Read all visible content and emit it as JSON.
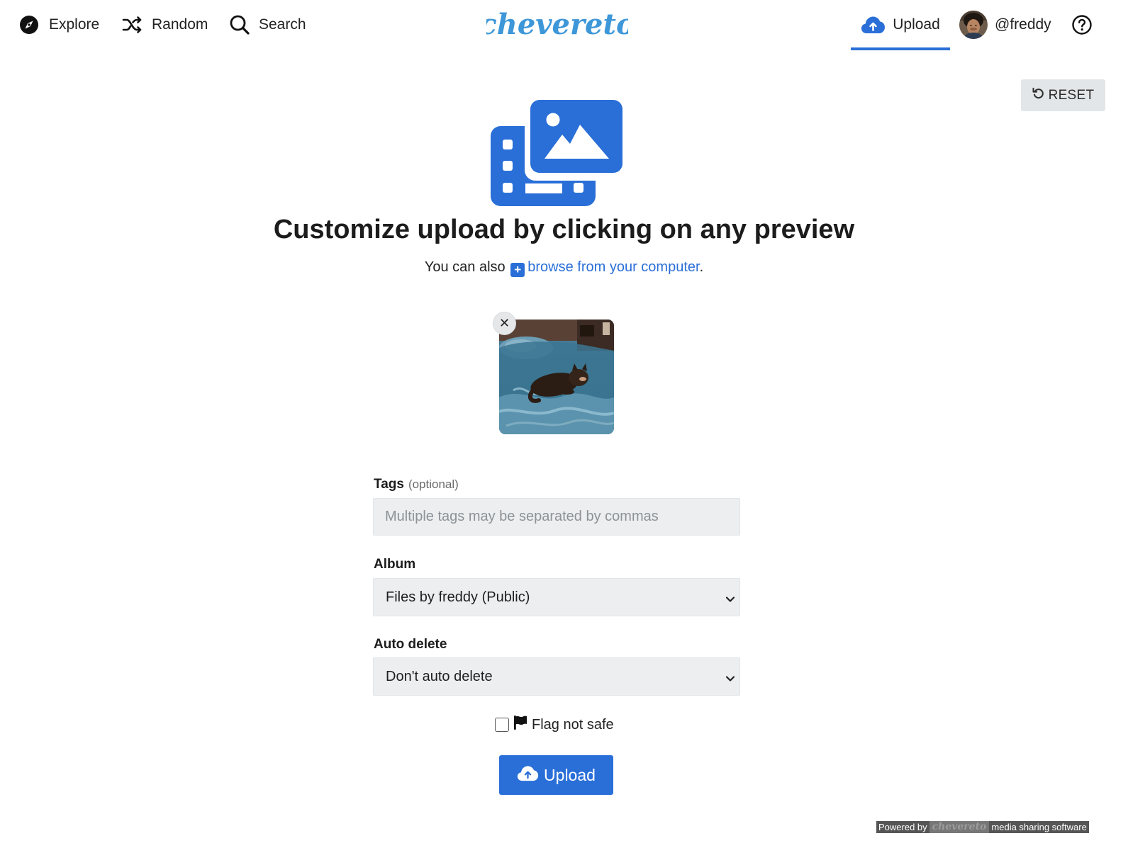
{
  "topbar": {
    "explore_label": "Explore",
    "random_label": "Random",
    "search_label": "Search",
    "logo_text": "chevereto",
    "upload_label": "Upload",
    "user_label": "@freddy"
  },
  "reset": {
    "label": "RESET"
  },
  "hero": {
    "title": "Customize upload by clicking on any preview",
    "sub_prefix": "You can also",
    "browse_link": "browse from your computer",
    "sub_suffix": "."
  },
  "preview": {
    "close_glyph": "✕"
  },
  "form": {
    "tags_label": "Tags",
    "tags_optional": "(optional)",
    "tags_placeholder": "Multiple tags may be separated by commas",
    "tags_value": "",
    "album_label": "Album",
    "album_value": "Files by freddy (Public)",
    "autodelete_label": "Auto delete",
    "autodelete_value": "Don't auto delete",
    "nsfw_label": "Flag not safe",
    "nsfw_checked": false,
    "upload_label": "Upload"
  },
  "footer": {
    "powered_prefix": "Powered by",
    "powered_brand": "chevereto",
    "powered_suffix": "media sharing software"
  },
  "colors": {
    "accent": "#2a6fd8",
    "logo": "#3d97d8",
    "input_bg": "#eceef0",
    "reset_bg": "#e3e6e8"
  },
  "icons": {
    "explore": "compass-icon",
    "random": "shuffle-icon",
    "search": "search-icon",
    "upload": "cloud-upload-icon",
    "help": "question-circle-icon",
    "reset": "undo-icon",
    "hero": "photo-video-icon",
    "browse": "plus-square-icon",
    "flag": "flag-icon",
    "select": "chevron-down-icon"
  }
}
